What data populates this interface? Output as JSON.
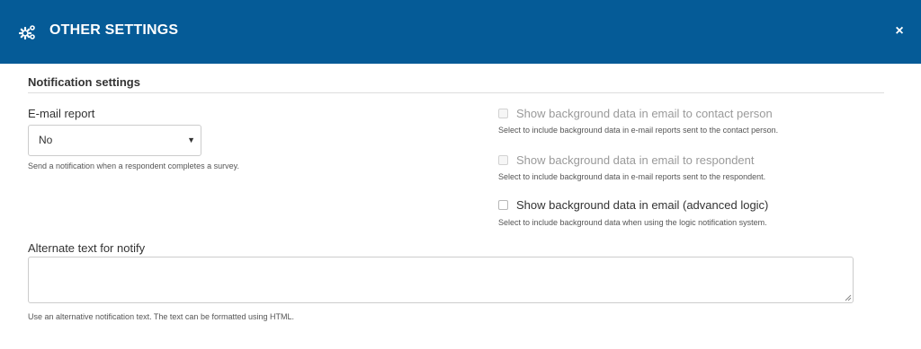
{
  "header": {
    "title": "OTHER SETTINGS",
    "icon": "gears-icon",
    "close_label": "×",
    "bg_color": "#055b97"
  },
  "notification": {
    "section_title": "Notification settings",
    "email_report": {
      "label": "E-mail report",
      "selected": "No",
      "help": "Send a notification when a respondent completes a survey."
    },
    "checkboxes": [
      {
        "label": "Show background data in email to contact person",
        "help": "Select to include background data in e-mail reports sent to the contact person.",
        "checked": false,
        "disabled": true
      },
      {
        "label": "Show background data in email to respondent",
        "help": "Select to include background data in e-mail reports sent to the respondent.",
        "checked": false,
        "disabled": true
      },
      {
        "label": "Show background data in email (advanced logic)",
        "help": "Select to include background data when using the logic notification system.",
        "checked": false,
        "disabled": false
      }
    ],
    "alternate_text": {
      "label": "Alternate text for notify",
      "value": "",
      "help": "Use an alternative notification text. The text can be formatted using HTML."
    }
  }
}
